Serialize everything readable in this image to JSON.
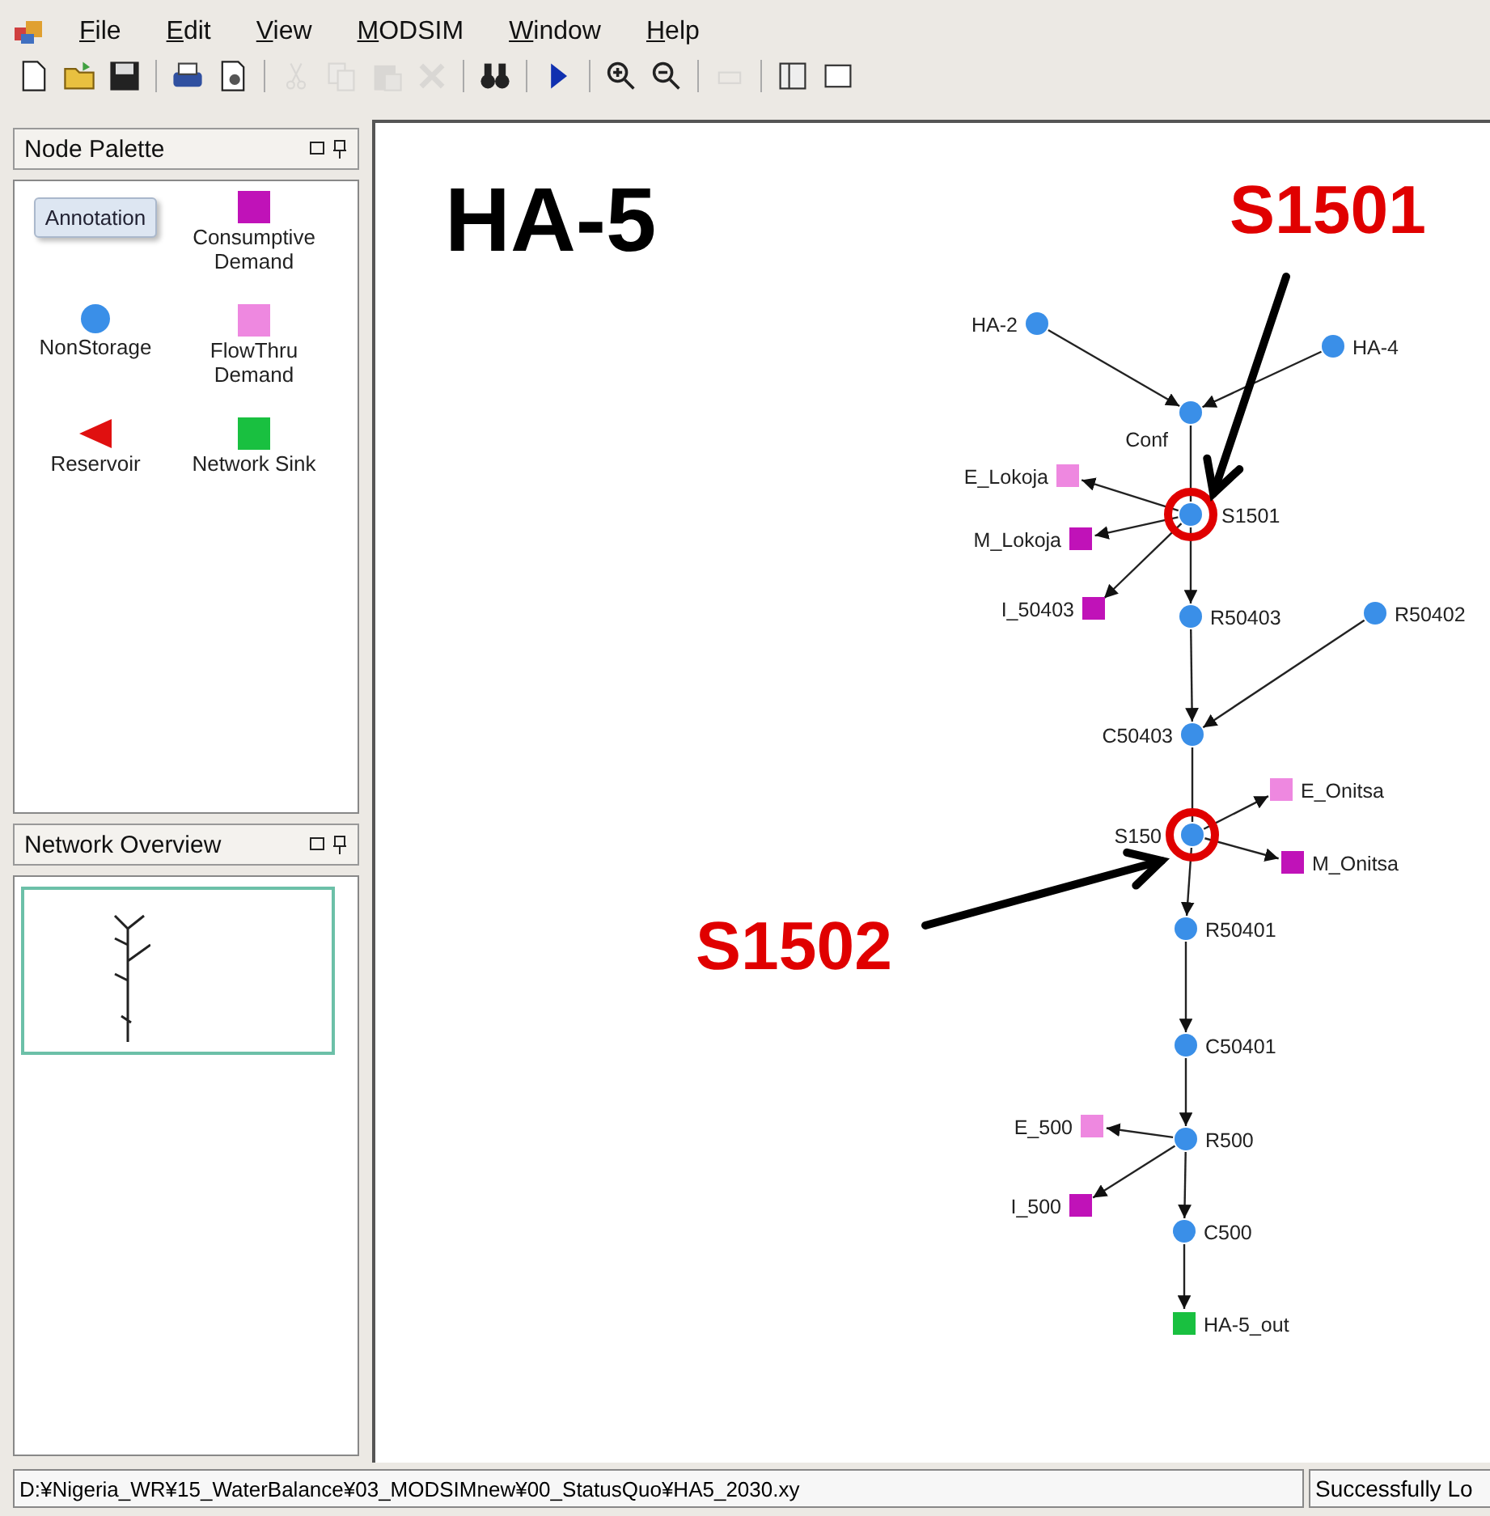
{
  "menu": [
    {
      "label": "File"
    },
    {
      "label": "Edit"
    },
    {
      "label": "View"
    },
    {
      "label": "MODSIM"
    },
    {
      "label": "Window"
    },
    {
      "label": "Help"
    }
  ],
  "toolbar": [
    {
      "kind": "new",
      "disabled": false
    },
    {
      "kind": "open",
      "disabled": false
    },
    {
      "kind": "save",
      "disabled": false
    },
    {
      "kind": "sep"
    },
    {
      "kind": "print",
      "disabled": false
    },
    {
      "kind": "preview",
      "disabled": false
    },
    {
      "kind": "sep"
    },
    {
      "kind": "cut",
      "disabled": true
    },
    {
      "kind": "copy",
      "disabled": true
    },
    {
      "kind": "paste",
      "disabled": true
    },
    {
      "kind": "delete",
      "disabled": true
    },
    {
      "kind": "sep"
    },
    {
      "kind": "find",
      "disabled": false
    },
    {
      "kind": "sep"
    },
    {
      "kind": "run",
      "disabled": false
    },
    {
      "kind": "sep"
    },
    {
      "kind": "zoomin",
      "disabled": false
    },
    {
      "kind": "zoomout",
      "disabled": false
    },
    {
      "kind": "sep"
    },
    {
      "kind": "undo",
      "disabled": true
    },
    {
      "kind": "sep"
    },
    {
      "kind": "panel",
      "disabled": false
    },
    {
      "kind": "window",
      "disabled": false
    }
  ],
  "node_palette": {
    "title": "Node Palette",
    "items": [
      {
        "kind": "annotation",
        "label": "Annotation"
      },
      {
        "kind": "consumptive",
        "label": "Consumptive Demand"
      },
      {
        "kind": "nonstorage",
        "label": "NonStorage"
      },
      {
        "kind": "flowthru",
        "label": "FlowThru Demand"
      },
      {
        "kind": "reservoir",
        "label": "Reservoir"
      },
      {
        "kind": "sink",
        "label": "Network Sink"
      }
    ]
  },
  "network_overview": {
    "title": "Network Overview"
  },
  "canvas": {
    "title": "HA-5",
    "nodes": [
      {
        "kind": "nonstorage",
        "label": "HA-2"
      },
      {
        "kind": "nonstorage",
        "label": "HA-4"
      },
      {
        "kind": "nonstorage",
        "label": "Conf"
      },
      {
        "kind": "flowthru",
        "label": "E_Lokoja"
      },
      {
        "kind": "nonstorage",
        "label": "S1501"
      },
      {
        "kind": "consumptive",
        "label": "M_Lokoja"
      },
      {
        "kind": "consumptive",
        "label": "I_50403"
      },
      {
        "kind": "nonstorage",
        "label": "R50403"
      },
      {
        "kind": "nonstorage",
        "label": "R50402"
      },
      {
        "kind": "nonstorage",
        "label": "C50403"
      },
      {
        "kind": "flowthru",
        "label": "E_Onitsa"
      },
      {
        "kind": "nonstorage",
        "label": "S150"
      },
      {
        "kind": "consumptive",
        "label": "M_Onitsa"
      },
      {
        "kind": "nonstorage",
        "label": "R50401"
      },
      {
        "kind": "nonstorage",
        "label": "C50401"
      },
      {
        "kind": "nonstorage",
        "label": "R500"
      },
      {
        "kind": "flowthru",
        "label": "E_500"
      },
      {
        "kind": "consumptive",
        "label": "I_500"
      },
      {
        "kind": "nonstorage",
        "label": "C500"
      },
      {
        "kind": "sink",
        "label": "HA-5_out"
      }
    ],
    "callouts": [
      {
        "text": "S1501"
      },
      {
        "text": "S1502"
      }
    ]
  },
  "status_bar": {
    "path": "D:¥Nigeria_WR¥15_WaterBalance¥03_MODSIMnew¥00_StatusQuo¥HA5_2030.xy",
    "message": "Successfully Lo"
  }
}
